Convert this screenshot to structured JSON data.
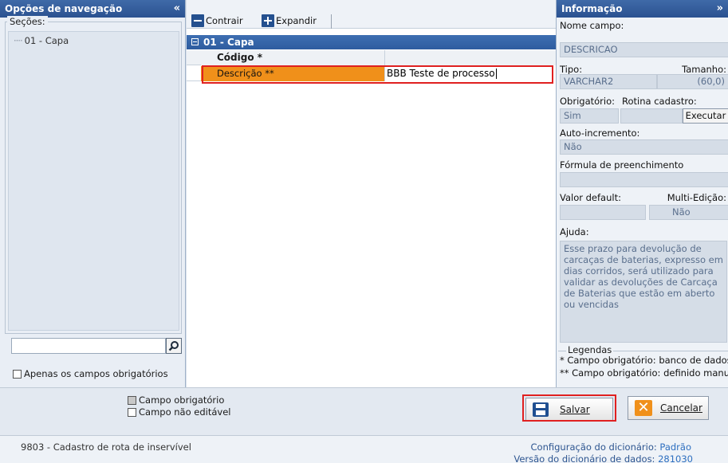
{
  "nav": {
    "title": "Opções de navegação",
    "collapse_glyph": "«",
    "sections_label": "Seções:",
    "tree_items": [
      {
        "label": "01 - Capa"
      }
    ],
    "search_value": "",
    "search_icon": "search-icon",
    "only_required_label": "Apenas os campos obrigatórios"
  },
  "center": {
    "toolbar": {
      "collapse_label": "Contrair",
      "expand_label": "Expandir"
    },
    "section_title": "01 - Capa",
    "rows": [
      {
        "label": "Código *",
        "value": ""
      },
      {
        "label": "Descrição **",
        "value": "BBB Teste de processo"
      }
    ]
  },
  "info": {
    "title": "Informação",
    "expand_glyph": "»",
    "nome_campo_label": "Nome campo:",
    "nome_campo_value": "DESCRICAO",
    "tipo_label": "Tipo:",
    "tamanho_label": "Tamanho:",
    "tipo_value": "VARCHAR2",
    "tamanho_value": "(60,0)",
    "obrigatorio_label": "Obrigatório:",
    "rotina_label": "Rotina cadastro:",
    "obrigatorio_value": "Sim",
    "rotina_value": "",
    "executar_label": "Executar",
    "auto_inc_label": "Auto-incremento:",
    "auto_inc_value": "Não",
    "formula_label": "Fórmula de preenchimento",
    "formula_value": "",
    "valor_default_label": "Valor default:",
    "multi_edicao_label": "Multi-Edição:",
    "valor_default_value": "",
    "multi_edicao_value": "Não",
    "ajuda_label": "Ajuda:",
    "ajuda_text": "Esse prazo para devolução de carcaças de baterias, expresso em dias corridos, será utilizado para validar as devoluções de Carcaça de Baterias que estão em aberto ou vencidas",
    "legendas_title": "Legendas",
    "legend_1": "* Campo obrigatório: banco de dados",
    "legend_2": "** Campo obrigatório: definido manua"
  },
  "bottom": {
    "campo_obrigatorio_label": "Campo obrigatório",
    "campo_nao_editavel_label": "Campo não editável",
    "save_label": "Salvar",
    "cancel_label": "Cancelar"
  },
  "status": {
    "left_text": "9803 - Cadastro de rota de inservível",
    "config_label": "Configuração do dicionário:",
    "config_value": "Padrão",
    "version_label": "Versão do dicionário de dados:",
    "version_value": "281030"
  },
  "colors": {
    "accent": "#2a5190",
    "highlight": "#f0901a",
    "focus": "#e02020"
  }
}
